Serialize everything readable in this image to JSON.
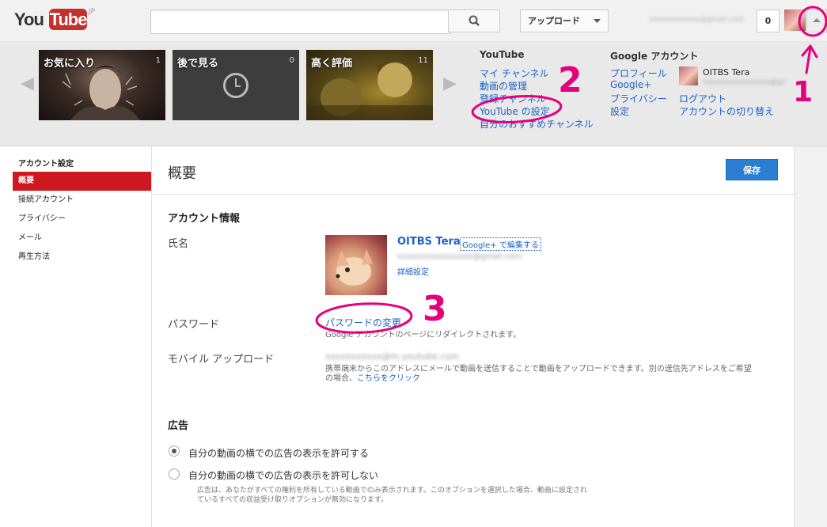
{
  "header": {
    "logo_you": "You",
    "logo_tube": "Tube",
    "logo_region": "JP",
    "search_placeholder": "",
    "upload_label": "アップロード",
    "email": "xxxxxxxxxxxx@gmail.com",
    "notification_count": "0"
  },
  "guide": {
    "thumbnails": [
      {
        "title": "お気に入り",
        "count": "1"
      },
      {
        "title": "後で見る",
        "count": "0"
      },
      {
        "title": "高く評価",
        "count": "11"
      }
    ],
    "youtube_heading": "YouTube",
    "youtube_links": [
      "マイ チャンネル",
      "動画の管理",
      "登録チャンネル",
      "YouTube の設定",
      "自分のおすすめチャンネル"
    ],
    "google_heading": "Google アカウント",
    "google_links": [
      "プロフィール",
      "Google+",
      "プライバシー",
      "設定"
    ],
    "account_name": "OITBS Tera",
    "account_email": "xxxxxxxxxxxxxxxxxx@gmail.com",
    "logout": "ログアウト",
    "switch_account": "アカウントの切り替え"
  },
  "sidebar": {
    "heading": "アカウント設定",
    "items": [
      "概要",
      "接続アカウント",
      "プライバシー",
      "メール",
      "再生方法"
    ]
  },
  "main": {
    "title": "概要",
    "save_label": "保存",
    "account_info_heading": "アカウント情報",
    "name_label": "氏名",
    "profile_name": "OITBS Tera",
    "google_plus_edit": "Google+ で編集する",
    "profile_email": "xxxxxxxxxxxxxxxx@gmail.com",
    "advanced_settings": "詳細設定",
    "password_label": "パスワード",
    "change_password": "パスワードの変更",
    "password_note": "Google アカウントのページにリダイレクトされます。",
    "mobile_upload_label": "モバイル アップロード",
    "mobile_upload_address": "xxxxxxxxxxx@m.youtube.com",
    "mobile_note_1": "携帯端末からこのアドレスにメールで動画を送信することで動画をアップロードできます。別の送信先アドレスをご希望",
    "mobile_note_2a": "の場合、",
    "mobile_note_2_link": "こちらをクリック",
    "ads_heading": "広告",
    "ads_option_allow": "自分の動画の横での広告の表示を許可する",
    "ads_option_deny": "自分の動画の横での広告の表示を許可しない",
    "ads_note_1": "広告は、あなたがすべての権利を所有している動画でのみ表示されます。このオプションを選択した場合、動画に設定され",
    "ads_note_2": "ているすべての収益受け取りオプションが無効になります。"
  },
  "annotations": {
    "step1": "1",
    "step2": "2",
    "step3": "3",
    "color": "#e6007e"
  }
}
